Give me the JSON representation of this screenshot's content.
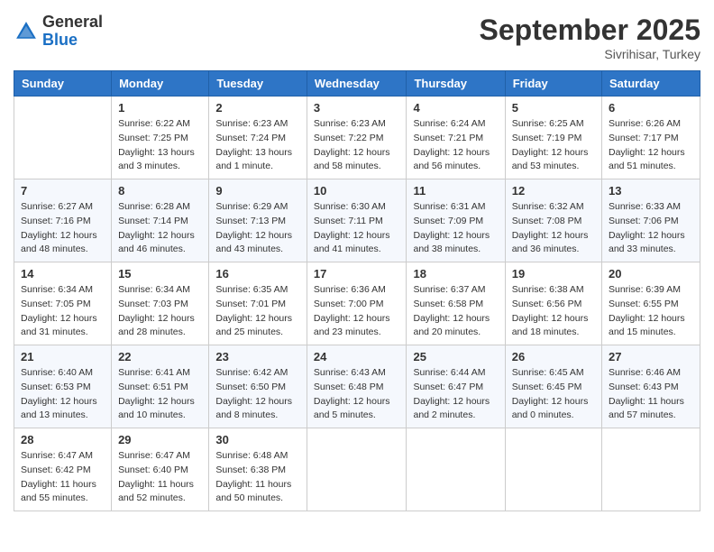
{
  "header": {
    "logo_general": "General",
    "logo_blue": "Blue",
    "month_title": "September 2025",
    "location": "Sivrihisar, Turkey"
  },
  "days_of_week": [
    "Sunday",
    "Monday",
    "Tuesday",
    "Wednesday",
    "Thursday",
    "Friday",
    "Saturday"
  ],
  "weeks": [
    [
      {
        "day": "",
        "info": ""
      },
      {
        "day": "1",
        "info": "Sunrise: 6:22 AM\nSunset: 7:25 PM\nDaylight: 13 hours\nand 3 minutes."
      },
      {
        "day": "2",
        "info": "Sunrise: 6:23 AM\nSunset: 7:24 PM\nDaylight: 13 hours\nand 1 minute."
      },
      {
        "day": "3",
        "info": "Sunrise: 6:23 AM\nSunset: 7:22 PM\nDaylight: 12 hours\nand 58 minutes."
      },
      {
        "day": "4",
        "info": "Sunrise: 6:24 AM\nSunset: 7:21 PM\nDaylight: 12 hours\nand 56 minutes."
      },
      {
        "day": "5",
        "info": "Sunrise: 6:25 AM\nSunset: 7:19 PM\nDaylight: 12 hours\nand 53 minutes."
      },
      {
        "day": "6",
        "info": "Sunrise: 6:26 AM\nSunset: 7:17 PM\nDaylight: 12 hours\nand 51 minutes."
      }
    ],
    [
      {
        "day": "7",
        "info": "Sunrise: 6:27 AM\nSunset: 7:16 PM\nDaylight: 12 hours\nand 48 minutes."
      },
      {
        "day": "8",
        "info": "Sunrise: 6:28 AM\nSunset: 7:14 PM\nDaylight: 12 hours\nand 46 minutes."
      },
      {
        "day": "9",
        "info": "Sunrise: 6:29 AM\nSunset: 7:13 PM\nDaylight: 12 hours\nand 43 minutes."
      },
      {
        "day": "10",
        "info": "Sunrise: 6:30 AM\nSunset: 7:11 PM\nDaylight: 12 hours\nand 41 minutes."
      },
      {
        "day": "11",
        "info": "Sunrise: 6:31 AM\nSunset: 7:09 PM\nDaylight: 12 hours\nand 38 minutes."
      },
      {
        "day": "12",
        "info": "Sunrise: 6:32 AM\nSunset: 7:08 PM\nDaylight: 12 hours\nand 36 minutes."
      },
      {
        "day": "13",
        "info": "Sunrise: 6:33 AM\nSunset: 7:06 PM\nDaylight: 12 hours\nand 33 minutes."
      }
    ],
    [
      {
        "day": "14",
        "info": "Sunrise: 6:34 AM\nSunset: 7:05 PM\nDaylight: 12 hours\nand 31 minutes."
      },
      {
        "day": "15",
        "info": "Sunrise: 6:34 AM\nSunset: 7:03 PM\nDaylight: 12 hours\nand 28 minutes."
      },
      {
        "day": "16",
        "info": "Sunrise: 6:35 AM\nSunset: 7:01 PM\nDaylight: 12 hours\nand 25 minutes."
      },
      {
        "day": "17",
        "info": "Sunrise: 6:36 AM\nSunset: 7:00 PM\nDaylight: 12 hours\nand 23 minutes."
      },
      {
        "day": "18",
        "info": "Sunrise: 6:37 AM\nSunset: 6:58 PM\nDaylight: 12 hours\nand 20 minutes."
      },
      {
        "day": "19",
        "info": "Sunrise: 6:38 AM\nSunset: 6:56 PM\nDaylight: 12 hours\nand 18 minutes."
      },
      {
        "day": "20",
        "info": "Sunrise: 6:39 AM\nSunset: 6:55 PM\nDaylight: 12 hours\nand 15 minutes."
      }
    ],
    [
      {
        "day": "21",
        "info": "Sunrise: 6:40 AM\nSunset: 6:53 PM\nDaylight: 12 hours\nand 13 minutes."
      },
      {
        "day": "22",
        "info": "Sunrise: 6:41 AM\nSunset: 6:51 PM\nDaylight: 12 hours\nand 10 minutes."
      },
      {
        "day": "23",
        "info": "Sunrise: 6:42 AM\nSunset: 6:50 PM\nDaylight: 12 hours\nand 8 minutes."
      },
      {
        "day": "24",
        "info": "Sunrise: 6:43 AM\nSunset: 6:48 PM\nDaylight: 12 hours\nand 5 minutes."
      },
      {
        "day": "25",
        "info": "Sunrise: 6:44 AM\nSunset: 6:47 PM\nDaylight: 12 hours\nand 2 minutes."
      },
      {
        "day": "26",
        "info": "Sunrise: 6:45 AM\nSunset: 6:45 PM\nDaylight: 12 hours\nand 0 minutes."
      },
      {
        "day": "27",
        "info": "Sunrise: 6:46 AM\nSunset: 6:43 PM\nDaylight: 11 hours\nand 57 minutes."
      }
    ],
    [
      {
        "day": "28",
        "info": "Sunrise: 6:47 AM\nSunset: 6:42 PM\nDaylight: 11 hours\nand 55 minutes."
      },
      {
        "day": "29",
        "info": "Sunrise: 6:47 AM\nSunset: 6:40 PM\nDaylight: 11 hours\nand 52 minutes."
      },
      {
        "day": "30",
        "info": "Sunrise: 6:48 AM\nSunset: 6:38 PM\nDaylight: 11 hours\nand 50 minutes."
      },
      {
        "day": "",
        "info": ""
      },
      {
        "day": "",
        "info": ""
      },
      {
        "day": "",
        "info": ""
      },
      {
        "day": "",
        "info": ""
      }
    ]
  ]
}
